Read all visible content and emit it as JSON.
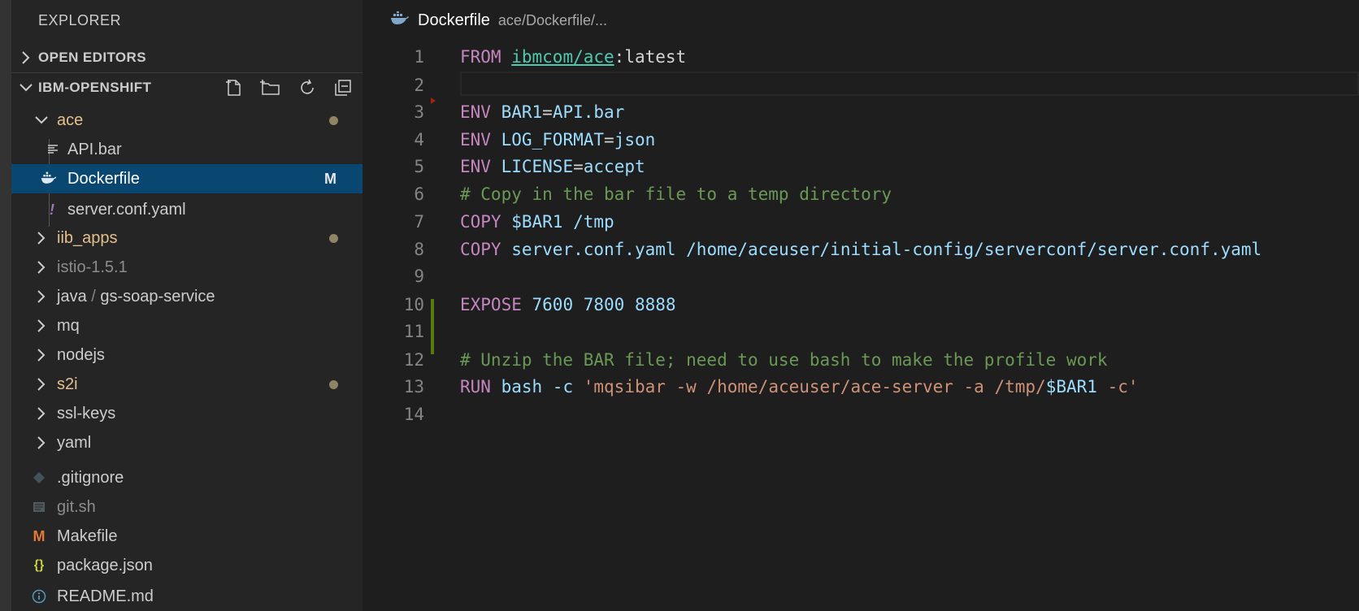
{
  "explorer": {
    "title": "EXPLORER",
    "open_editors": "OPEN EDITORS",
    "workspace": "IBM-OPENSHIFT",
    "actions": [
      "new-file-icon",
      "new-folder-icon",
      "refresh-icon",
      "collapse-all-icon"
    ]
  },
  "tree": {
    "ace": "ace",
    "api_bar": "API.bar",
    "dockerfile": "Dockerfile",
    "dockerfile_status": "M",
    "server_conf": "server.conf.yaml",
    "iib_apps": "iib_apps",
    "istio": "istio-1.5.1",
    "java": "java",
    "java_sep": "/",
    "gs_soap": "gs-soap-service",
    "mq": "mq",
    "nodejs": "nodejs",
    "s2i": "s2i",
    "ssl_keys": "ssl-keys",
    "yaml": "yaml",
    "gitignore": ".gitignore",
    "git_sh": "git.sh",
    "makefile": "Makefile",
    "makefile_icon": "M",
    "package_json": "package.json",
    "package_icon": "{}",
    "readme": "README.md",
    "server_icon": "!"
  },
  "tab": {
    "name": "Dockerfile",
    "path": "ace/Dockerfile/..."
  },
  "editor": {
    "line_numbers": [
      "1",
      "2",
      "3",
      "4",
      "5",
      "6",
      "7",
      "8",
      "9",
      "10",
      "11",
      "12",
      "13",
      "14"
    ],
    "l1": {
      "kw": "FROM",
      "img": "ibmcom/ace",
      "tag": ":latest"
    },
    "l3": {
      "kw": "ENV",
      "var": "BAR1",
      "eq": "=",
      "val": "API.bar"
    },
    "l4": {
      "kw": "ENV",
      "var": "LOG_FORMAT",
      "eq": "=",
      "val": "json"
    },
    "l5": {
      "kw": "ENV",
      "var": "LICENSE",
      "eq": "=",
      "val": "accept"
    },
    "l6": "# Copy in the bar file to a temp directory",
    "l7": {
      "kw": "COPY",
      "var": "$BAR1",
      "rest": " /tmp"
    },
    "l8": {
      "kw": "COPY",
      "rest": "server.conf.yaml /home/aceuser/initial-config/serverconf/server.conf.yaml"
    },
    "l10": {
      "kw": "EXPOSE",
      "rest": "7600 7800 8888"
    },
    "l12": "# Unzip the BAR file; need to use bash to make the profile work",
    "l13": {
      "kw": "RUN",
      "cmd": "bash -c ",
      "str1": "'mqsibar -w /home/aceuser/ace-server -a /tmp/",
      "var": "$BAR1",
      "str2": " -c'"
    }
  }
}
